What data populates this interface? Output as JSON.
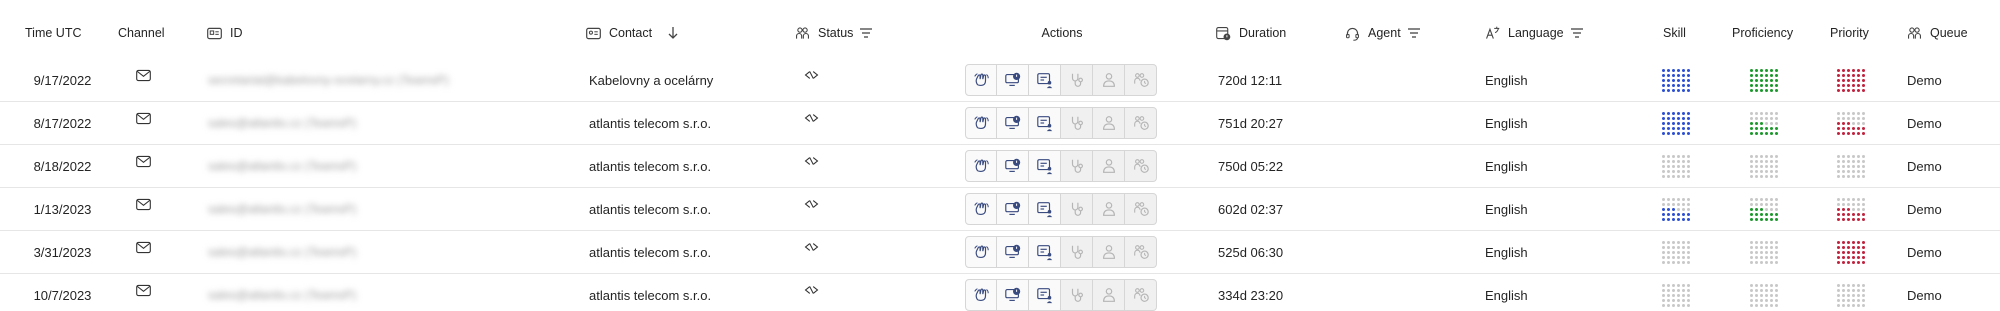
{
  "colors": {
    "skill": "#2c4fd1",
    "proficiency": "#1a9a2a",
    "priority": "#c0223e",
    "dot_inactive": "#c8c8c8",
    "icon_active": "#3a4b80",
    "icon_disabled": "#b5b5b5"
  },
  "header": {
    "time": "Time UTC",
    "channel": "Channel",
    "id": "ID",
    "contact": "Contact",
    "status": "Status",
    "actions": "Actions",
    "duration": "Duration",
    "agent": "Agent",
    "language": "Language",
    "skill": "Skill",
    "proficiency": "Proficiency",
    "priority": "Priority",
    "queue": "Queue"
  },
  "rows": [
    {
      "time": "9/17/2022",
      "channel_icon": "mail-icon",
      "id": "secretariat@kabelovny-ocelarny.cz (TeamsP)",
      "contact": "Kabelovny a ocelárny",
      "status_icon": "status-link-icon",
      "duration": "720d 12:11",
      "language": "English",
      "skill": 1,
      "proficiency": 1,
      "priority": 1,
      "queue": "Demo"
    },
    {
      "time": "8/17/2022",
      "channel_icon": "mail-icon",
      "id": "sales@atlantis.cz (TeamsP)",
      "contact": "atlantis telecom s.r.o.",
      "status_icon": "status-link-icon",
      "duration": "751d 20:27",
      "language": "English",
      "skill": 1,
      "proficiency": 0.5,
      "priority": 0.5,
      "queue": "Demo"
    },
    {
      "time": "8/18/2022",
      "channel_icon": "mail-icon",
      "id": "sales@atlantis.cz (TeamsP)",
      "contact": "atlantis telecom s.r.o.",
      "status_icon": "status-link-icon",
      "duration": "750d 05:22",
      "language": "English",
      "skill": 0,
      "proficiency": 0,
      "priority": 0,
      "queue": "Demo"
    },
    {
      "time": "1/13/2023",
      "channel_icon": "mail-icon",
      "id": "sales@atlantis.cz (TeamsP)",
      "contact": "atlantis telecom s.r.o.",
      "status_icon": "status-link-icon",
      "duration": "602d 02:37",
      "language": "English",
      "skill": 0.5,
      "proficiency": 0.5,
      "priority": 0.5,
      "queue": "Demo"
    },
    {
      "time": "3/31/2023",
      "channel_icon": "mail-icon",
      "id": "sales@atlantis.cz (TeamsP)",
      "contact": "atlantis telecom s.r.o.",
      "status_icon": "status-link-icon",
      "duration": "525d 06:30",
      "language": "English",
      "skill": 0,
      "proficiency": 0,
      "priority": 1,
      "queue": "Demo"
    },
    {
      "time": "10/7/2023",
      "channel_icon": "mail-icon",
      "id": "sales@atlantis.cz (TeamsP)",
      "contact": "atlantis telecom s.r.o.",
      "status_icon": "status-link-icon",
      "duration": "334d 23:20",
      "language": "English",
      "skill": 0,
      "proficiency": 0,
      "priority": 0,
      "queue": "Demo"
    }
  ],
  "actions": [
    {
      "name": "wave-hand-icon",
      "enabled": true
    },
    {
      "name": "monitor-clock-icon",
      "enabled": true
    },
    {
      "name": "card-person-icon",
      "enabled": true
    },
    {
      "name": "stethoscope-icon",
      "enabled": false
    },
    {
      "name": "person-icon",
      "enabled": false
    },
    {
      "name": "group-clock-icon",
      "enabled": false
    }
  ]
}
